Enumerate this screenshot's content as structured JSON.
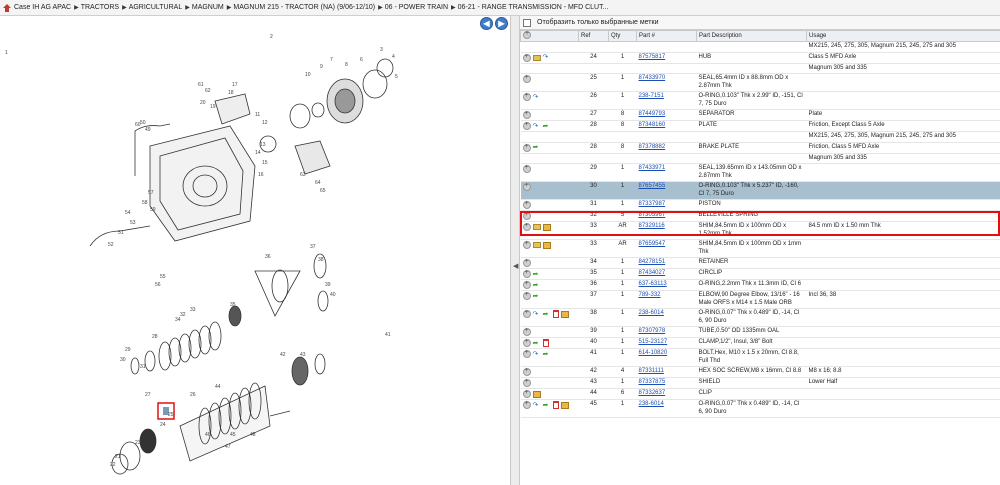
{
  "breadcrumb": [
    "Case IH AG APAC",
    "TRACTORS",
    "AGRICULTURAL",
    "MAGNUM",
    "MAGNUM 215 - TRACTOR (NA) (9/06-12/10)",
    "06 - POWER TRAIN",
    "06-21 - RANGE TRANSMISSION - MFD CLUT..."
  ],
  "nav": {
    "back": "◀",
    "forward": "▶"
  },
  "filter": {
    "label": "Отобразить только выбранные метки"
  },
  "columns": [
    "Ref",
    "Qty",
    "Part #",
    "Part Description",
    "Usage"
  ],
  "rows": [
    {
      "ref": "",
      "qty": "",
      "part": "",
      "desc": "",
      "usage": "MX215, 245, 275, 305, Magnum 215, 245, 275 and 305",
      "icons": []
    },
    {
      "ref": "24",
      "qty": "1",
      "part": "87575817",
      "desc": "HUB",
      "usage": "Class 5 MFD Axle",
      "icons": [
        "plus",
        "env",
        "blue"
      ]
    },
    {
      "ref": "",
      "qty": "",
      "part": "",
      "desc": "",
      "usage": "Magnum 305 and 335",
      "icons": []
    },
    {
      "ref": "25",
      "qty": "1",
      "part": "87433970",
      "desc": "SEAL,65.4mm ID x 88.8mm OD x 2.87mm Thk",
      "usage": "",
      "icons": [
        "plus"
      ]
    },
    {
      "ref": "26",
      "qty": "1",
      "part": "238-7151",
      "desc": "O-RING,0.103\" Thk x 2.99\" ID, -151, Cl 7, 75 Duro",
      "usage": "",
      "icons": [
        "plus",
        "blue"
      ]
    },
    {
      "ref": "27",
      "qty": "8",
      "part": "87449793",
      "desc": "SEPARATOR",
      "usage": "Plate",
      "icons": [
        "plus"
      ]
    },
    {
      "ref": "28",
      "qty": "8",
      "part": "87348160",
      "desc": "PLATE",
      "usage": "Friction, Except Class 5 Axle",
      "icons": [
        "plus",
        "blue",
        "green"
      ]
    },
    {
      "ref": "",
      "qty": "",
      "part": "",
      "desc": "",
      "usage": "MX215, 245, 275, 305, Magnum 215, 245, 275 and 305",
      "icons": []
    },
    {
      "ref": "28",
      "qty": "8",
      "part": "87378882",
      "desc": "BRAKE PLATE",
      "usage": "Friction, Class 5 MFD Axle",
      "icons": [
        "plus",
        "green"
      ]
    },
    {
      "ref": "",
      "qty": "",
      "part": "",
      "desc": "",
      "usage": "Magnum 305 and 335",
      "icons": []
    },
    {
      "ref": "29",
      "qty": "1",
      "part": "87433971",
      "desc": "SEAL,139.65mm ID x 143.05mm OD x 2.87mm Thk",
      "usage": "",
      "icons": [
        "plus"
      ]
    },
    {
      "ref": "30",
      "qty": "1",
      "part": "87657455",
      "desc": "O-RING,0.103\" Thk x 5.237\" ID, -160, Cl 7, 75 Duro",
      "usage": "",
      "icons": [
        "plus"
      ],
      "selected": true
    },
    {
      "ref": "31",
      "qty": "1",
      "part": "87337987",
      "desc": "PISTON",
      "usage": "",
      "icons": [
        "plus"
      ]
    },
    {
      "ref": "32",
      "qty": "5",
      "part": "87305967",
      "desc": "BELLEVILLE SPRING",
      "usage": "",
      "icons": [
        "plus"
      ]
    },
    {
      "ref": "33",
      "qty": "AR",
      "part": "87329116",
      "desc": "SHIM,84.5mm ID x 100mm OD x 1.52mm Thk",
      "usage": "84.5 mm ID x 1.50 mm Thk",
      "icons": [
        "plus",
        "env",
        "box"
      ]
    },
    {
      "ref": "33",
      "qty": "AR",
      "part": "87659547",
      "desc": "SHIM,84.5mm ID x 100mm OD x 1mm Thk",
      "usage": "",
      "icons": [
        "plus",
        "env",
        "box"
      ]
    },
    {
      "ref": "34",
      "qty": "1",
      "part": "84278151",
      "desc": "RETAINER",
      "usage": "",
      "icons": [
        "plus"
      ]
    },
    {
      "ref": "35",
      "qty": "1",
      "part": "87434027",
      "desc": "CIRCLIP",
      "usage": "",
      "icons": [
        "plus",
        "green"
      ]
    },
    {
      "ref": "36",
      "qty": "1",
      "part": "637-63113",
      "desc": "O-RING,2.2mm Thk x 11.3mm ID, Cl 6",
      "usage": "",
      "icons": [
        "plus",
        "green"
      ]
    },
    {
      "ref": "37",
      "qty": "1",
      "part": "789-332",
      "desc": "ELBOW,90 Degree Elbow, 13/16\" - 16 Male ORFS x M14 x 1.5 Male ORB",
      "usage": "Incl 36, 38",
      "icons": [
        "plus",
        "green"
      ]
    },
    {
      "ref": "38",
      "qty": "1",
      "part": "238-6014",
      "desc": "O-RING,0.07\" Thk x 0.489\" ID, -14, Cl 6, 90 Duro",
      "usage": "",
      "icons": [
        "plus",
        "blue",
        "green",
        "doc",
        "box"
      ]
    },
    {
      "ref": "39",
      "qty": "1",
      "part": "87307978",
      "desc": "TUBE,0.50\" OD 1335mm OAL",
      "usage": "",
      "icons": [
        "plus"
      ]
    },
    {
      "ref": "40",
      "qty": "1",
      "part": "515-23127",
      "desc": "CLAMP,1/2\", Insul, 3/8\" Bolt",
      "usage": "",
      "icons": [
        "plus",
        "green",
        "doc"
      ]
    },
    {
      "ref": "41",
      "qty": "1",
      "part": "614-10820",
      "desc": "BOLT,Hex, M10 x 1.5 x 20mm, Cl 8.8, Full Thd",
      "usage": "",
      "icons": [
        "plus",
        "blue",
        "green"
      ]
    },
    {
      "ref": "42",
      "qty": "4",
      "part": "87331111",
      "desc": "HEX SOC SCREW,M8 x 16mm, Cl 8.8",
      "usage": "M8 x 16; 8.8",
      "icons": [
        "plus"
      ]
    },
    {
      "ref": "43",
      "qty": "1",
      "part": "87337875",
      "desc": "SHIELD",
      "usage": "Lower Half",
      "icons": [
        "plus"
      ]
    },
    {
      "ref": "44",
      "qty": "6",
      "part": "87332637",
      "desc": "CLIP",
      "usage": "",
      "icons": [
        "plus",
        "box"
      ]
    },
    {
      "ref": "45",
      "qty": "1",
      "part": "238-6014",
      "desc": "O-RING,0.07\" Thk x 0.489\" ID, -14, Cl 6, 90 Duro",
      "usage": "",
      "icons": [
        "plus",
        "blue",
        "green",
        "doc",
        "box"
      ]
    }
  ],
  "diagram": {
    "labels": [
      "1",
      "2",
      "3",
      "4",
      "5",
      "6",
      "7",
      "8",
      "9",
      "10",
      "11",
      "12",
      "13",
      "14",
      "15",
      "16",
      "17",
      "18",
      "19",
      "20",
      "21",
      "22",
      "23",
      "24",
      "25",
      "26",
      "27",
      "28",
      "29",
      "30",
      "31",
      "32",
      "33",
      "34",
      "35",
      "36",
      "37",
      "38",
      "39",
      "40",
      "41",
      "42",
      "43",
      "44",
      "45",
      "46",
      "47",
      "48",
      "49",
      "50",
      "51",
      "52",
      "53",
      "54",
      "55",
      "56",
      "57",
      "58",
      "59",
      "60",
      "61",
      "62",
      "63",
      "64",
      "65"
    ]
  }
}
